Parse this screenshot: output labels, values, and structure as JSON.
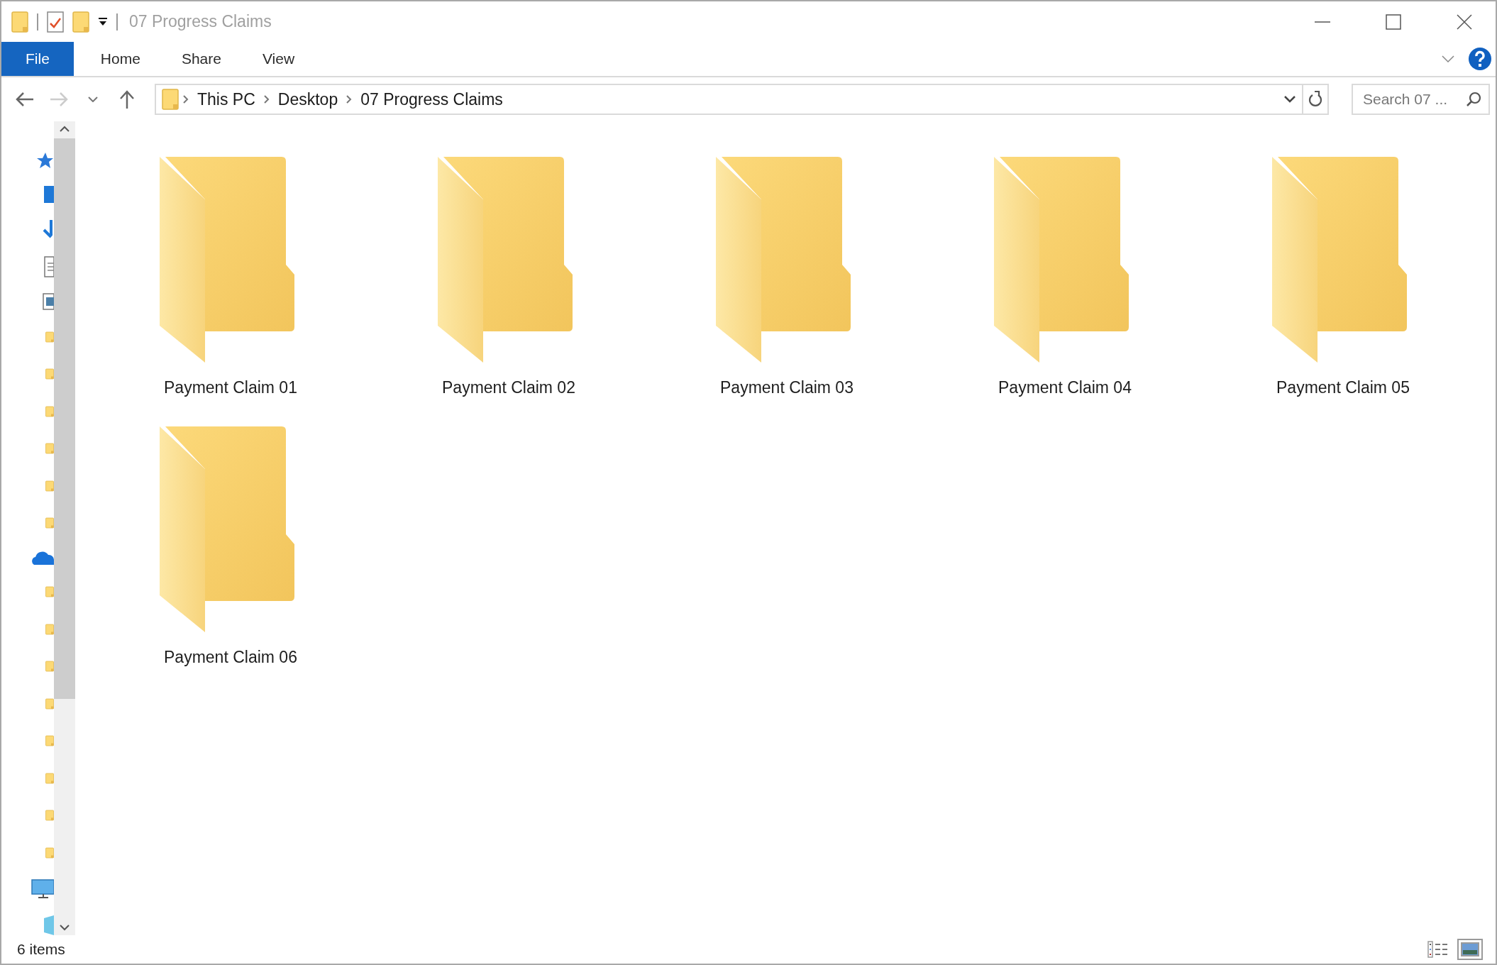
{
  "window": {
    "title": "07 Progress Claims"
  },
  "ribbon_tabs": [
    {
      "label": "File",
      "kind": "file"
    },
    {
      "label": "Home",
      "kind": "tab"
    },
    {
      "label": "Share",
      "kind": "tab"
    },
    {
      "label": "View",
      "kind": "tab"
    }
  ],
  "breadcrumb": [
    "This PC",
    "Desktop",
    "07 Progress Claims"
  ],
  "search": {
    "placeholder": "Search 07 ..."
  },
  "folders": [
    "Payment Claim 01",
    "Payment Claim 02",
    "Payment Claim 03",
    "Payment Claim 04",
    "Payment Claim 05",
    "Payment Claim 06"
  ],
  "status_bar": {
    "count": "6 items",
    "views": [
      {
        "kind": "details",
        "selected": false
      },
      {
        "kind": "large-icons",
        "selected": true
      }
    ]
  }
}
